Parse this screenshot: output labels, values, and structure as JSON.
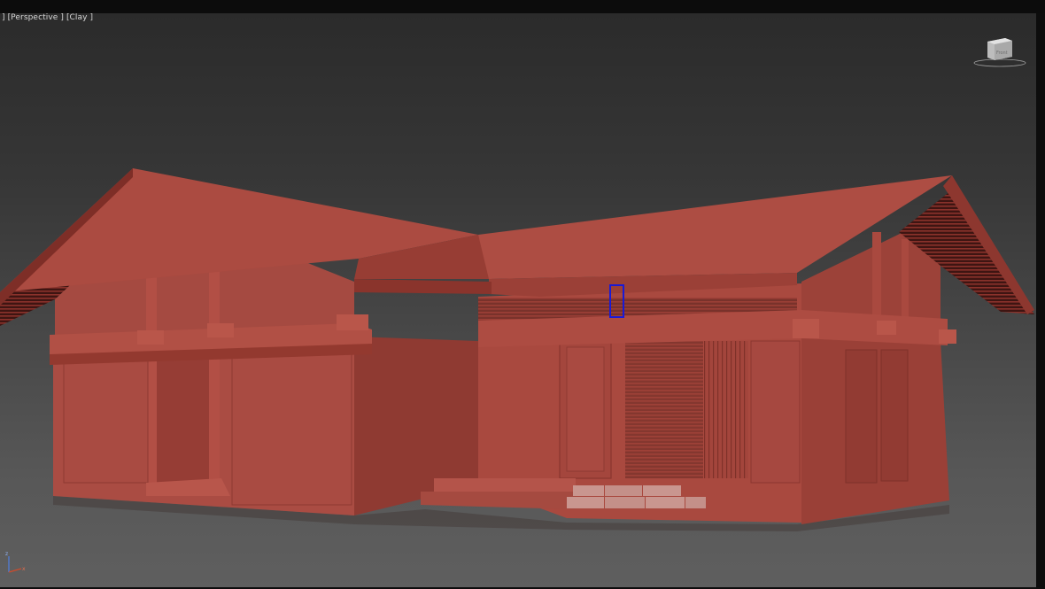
{
  "viewport": {
    "label": "] [Perspective ] [Clay ]",
    "shading_color": "#a9483f",
    "selection_color": "#1a1ad6"
  },
  "viewcube": {
    "face_label": "Front",
    "icon": "viewcube-icon"
  },
  "axis_tripod": {
    "icon": "axis-tripod-icon",
    "z_label": "z",
    "x_label": "x"
  }
}
